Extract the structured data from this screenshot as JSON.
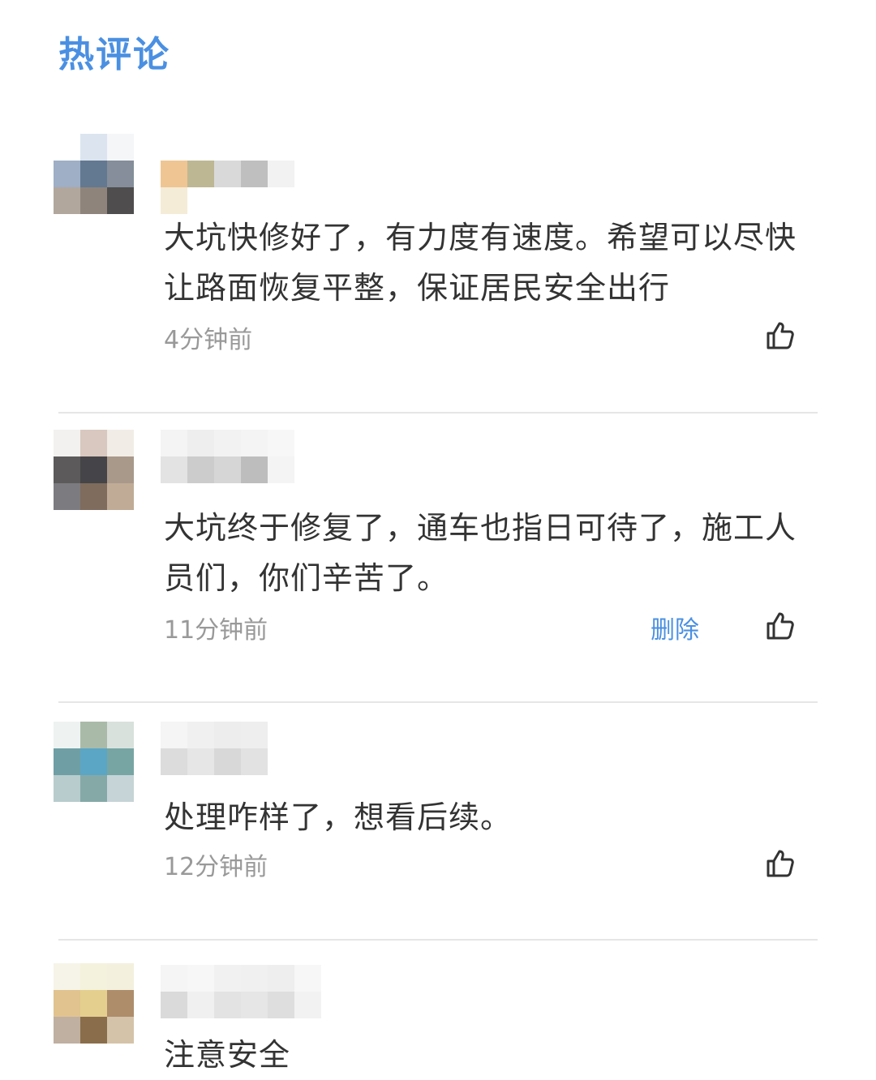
{
  "section": {
    "title": "热评论"
  },
  "comments": [
    {
      "text": "大坑快修好了，有力度有速度。希望可以尽快让路面恢复平整，保证居民安全出行",
      "time": "4分钟前",
      "delete_label": "",
      "avatar_colors": [
        "#ffffff",
        "#dbe4ef",
        "#f4f6f8",
        "#9eafc6",
        "#637891",
        "#858e9a",
        "#b1a79c",
        "#8e847c",
        "#4f4d4d"
      ],
      "name_colors": [
        "#efc593",
        "#bdb794",
        "#d9d9d9",
        "#bfbfbf",
        "#f2f2f2",
        "#ffffff",
        "#f5ecd7",
        "#ffffff",
        "#ffffff",
        "#ffffff",
        "#ffffff",
        "#ffffff"
      ]
    },
    {
      "text": "大坑终于修复了，通车也指日可待了，施工人员们，你们辛苦了。",
      "time": "11分钟前",
      "delete_label": "删除",
      "avatar_colors": [
        "#f3f1ef",
        "#d9c8bf",
        "#f1ece6",
        "#5d5a5b",
        "#454448",
        "#a9998a",
        "#7c7b7f",
        "#7f6c5d",
        "#c0ab96"
      ],
      "name_colors": [
        "#f4f4f4",
        "#eeeeee",
        "#f2f2f2",
        "#f4f4f4",
        "#f7f7f7",
        "#ffffff",
        "#e3e3e3",
        "#cccccc",
        "#d6d6d6",
        "#bdbdbd",
        "#f4f4f4",
        "#ffffff"
      ]
    },
    {
      "text": "处理咋样了，想看后续。",
      "time": "12分钟前",
      "delete_label": "",
      "avatar_colors": [
        "#eef3f2",
        "#a9bba8",
        "#d9e1dd",
        "#6f9fa4",
        "#5ba6c5",
        "#77a5a3",
        "#b8cccd",
        "#85a9a7",
        "#c6d4d7"
      ],
      "name_colors": [
        "#f5f5f5",
        "#f0f0f0",
        "#ededed",
        "#eeeeee",
        "#ffffff",
        "#ffffff",
        "#dcdcdc",
        "#e6e6e6",
        "#d8d8d8",
        "#e2e2e2",
        "#ffffff",
        "#ffffff"
      ]
    },
    {
      "text": "注意安全",
      "time": "",
      "delete_label": "",
      "avatar_colors": [
        "#f6f4e8",
        "#f4f2dd",
        "#f3f0de",
        "#e0c38f",
        "#e5cf8f",
        "#ae8d6b",
        "#bfb0a1",
        "#8a6d4b",
        "#d4c3a9"
      ],
      "name_colors": [
        "#f5f5f5",
        "#f7f7f7",
        "#f1f1f1",
        "#f0f0f0",
        "#eeeeee",
        "#f7f7f7",
        "#dadada",
        "#f0f0f0",
        "#e3e3e3",
        "#e6e6e6",
        "#dedede",
        "#f2f2f2"
      ]
    }
  ]
}
